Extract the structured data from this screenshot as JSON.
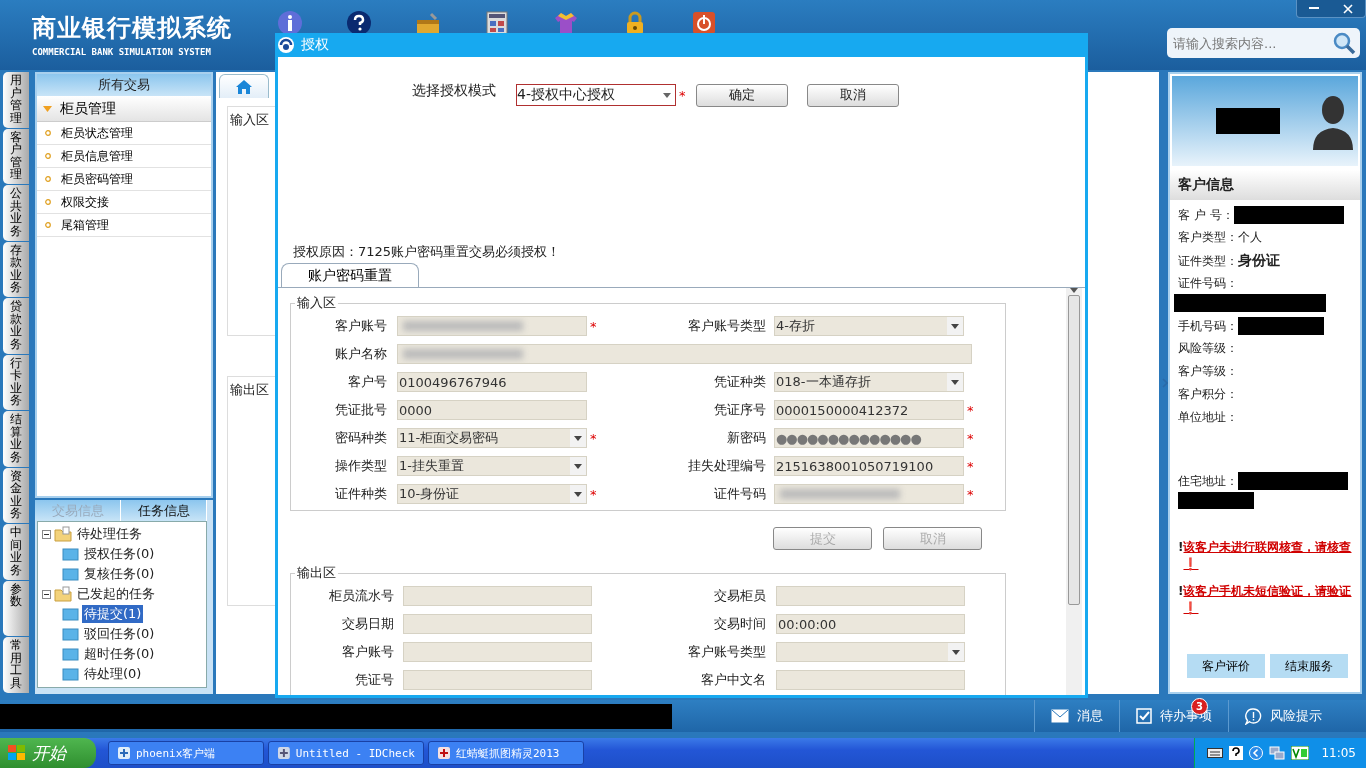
{
  "header": {
    "title": "商业银行模拟系统",
    "subtitle": "COMMERCIAL BANK SIMULATION SYSTEM",
    "search": {
      "placeholder": "请输入搜索内容..."
    }
  },
  "side_tabs": [
    {
      "label": "用户管理"
    },
    {
      "label": "客户管理"
    },
    {
      "label": "公共业务"
    },
    {
      "label": "存款业务"
    },
    {
      "label": "贷款业务"
    },
    {
      "label": "行卡业务"
    },
    {
      "label": "结算业务"
    },
    {
      "label": "资金业务"
    },
    {
      "label": "中间业务"
    },
    {
      "label": "参数"
    },
    {
      "label": "常用工具"
    }
  ],
  "nav": {
    "title": "所有交易",
    "groups": [
      {
        "label": "柜员管理",
        "expanded": true,
        "items": [
          {
            "label": "柜员状态管理"
          },
          {
            "label": "柜员信息管理"
          },
          {
            "label": "柜员密码管理"
          },
          {
            "label": "权限交接"
          },
          {
            "label": "尾箱管理"
          }
        ]
      }
    ]
  },
  "task_panel": {
    "tabs": [
      {
        "label": "交易信息",
        "selected": false
      },
      {
        "label": "任务信息",
        "selected": true
      }
    ],
    "tree": [
      {
        "label": "待处理任务",
        "expanded": true,
        "children": [
          {
            "label": "授权任务(0)",
            "selected": false
          },
          {
            "label": "复核任务(0)",
            "selected": false
          }
        ]
      },
      {
        "label": "已发起的任务",
        "expanded": true,
        "children": [
          {
            "label": "待提交(1)",
            "selected": true
          },
          {
            "label": "驳回任务(0)",
            "selected": false
          },
          {
            "label": "超时任务(0)",
            "selected": false
          },
          {
            "label": "待处理(0)",
            "selected": false
          }
        ]
      }
    ]
  },
  "workspace": {
    "input_label": "输入区",
    "output_label": "输出区"
  },
  "dialog": {
    "title": "授权",
    "mode": {
      "label": "选择授权模式",
      "value": "4-授权中心授权",
      "required_mark": "*"
    },
    "buttons": [
      {
        "label": "确定"
      },
      {
        "label": "取消"
      }
    ],
    "reason": "授权原因：7125账户密码重置交易必须授权！",
    "tab": {
      "label": "账户密码重置",
      "selected": true
    },
    "input": {
      "legend": "输入区",
      "rows": [
        {
          "fields": [
            {
              "label": "客户账号",
              "kind": "text",
              "blurred": true,
              "required_mark": "*"
            },
            {
              "label": "客户账号类型",
              "kind": "select",
              "value": "4-存折"
            }
          ]
        },
        {
          "fields": [
            {
              "label": "账户名称",
              "kind": "wide",
              "blurred": true
            }
          ]
        },
        {
          "fields": [
            {
              "label": "客户号",
              "kind": "text",
              "value": "0100496767946"
            },
            {
              "label": "凭证种类",
              "kind": "select",
              "value": "018-一本通存折"
            }
          ]
        },
        {
          "fields": [
            {
              "label": "凭证批号",
              "kind": "text",
              "value": "0000"
            },
            {
              "label": "凭证序号",
              "kind": "text",
              "value": "0000150000412372",
              "required_mark": "*"
            }
          ]
        },
        {
          "fields": [
            {
              "label": "密码种类",
              "kind": "select",
              "value": "11-柜面交易密码",
              "required_mark": "*"
            },
            {
              "label": "新密码",
              "kind": "password",
              "value": "●●●●●●●●●●●●●●",
              "required_mark": "*"
            }
          ]
        },
        {
          "fields": [
            {
              "label": "操作类型",
              "kind": "select",
              "value": "1-挂失重置"
            },
            {
              "label": "挂失处理编号",
              "kind": "text",
              "value": "2151638001050719100",
              "required_mark": "*"
            }
          ]
        },
        {
          "fields": [
            {
              "label": "证件种类",
              "kind": "select",
              "value": "10-身份证",
              "required_mark": "*"
            },
            {
              "label": "证件号码",
              "kind": "text",
              "blurred": true,
              "required_mark": "*"
            }
          ]
        }
      ]
    },
    "actions": [
      {
        "label": "提交",
        "disabled": true
      },
      {
        "label": "取消",
        "disabled": true
      }
    ],
    "output": {
      "legend": "输出区",
      "rows": [
        {
          "fields": [
            {
              "label": "柜员流水号",
              "kind": "text"
            },
            {
              "label": "交易柜员",
              "kind": "text"
            }
          ]
        },
        {
          "fields": [
            {
              "label": "交易日期",
              "kind": "text"
            },
            {
              "label": "交易时间",
              "kind": "text",
              "value": "00:00:00"
            }
          ]
        },
        {
          "fields": [
            {
              "label": "客户账号",
              "kind": "text"
            },
            {
              "label": "客户账号类型",
              "kind": "select"
            }
          ]
        },
        {
          "fields": [
            {
              "label": "凭证号",
              "kind": "text"
            },
            {
              "label": "客户中文名",
              "kind": "text"
            }
          ]
        }
      ]
    }
  },
  "customer": {
    "name_redacted": true,
    "title": "客户信息",
    "fields": [
      {
        "label": "客 户 号：",
        "kind": "line",
        "redacted": true
      },
      {
        "label": "客户类型：",
        "kind": "line",
        "value": "个人",
        "emphasis": false
      },
      {
        "label": "证件类型：",
        "kind": "line",
        "value": "身份证",
        "emphasis": true
      },
      {
        "label": "证件号码：",
        "kind": "line",
        "redacted": true
      },
      {
        "label": "手机号码：",
        "kind": "line",
        "redacted": true
      },
      {
        "label": "风险等级：",
        "kind": "line"
      },
      {
        "label": "客户等级：",
        "kind": "line"
      },
      {
        "label": "客户积分：",
        "kind": "line"
      },
      {
        "label": "单位地址：",
        "kind": "address"
      },
      {
        "label": "住宅地址：",
        "kind": "address",
        "redacted": true
      }
    ],
    "warnings": [
      {
        "mark": "!",
        "text": "该客户未进行联网核查，请核查❗"
      },
      {
        "mark": "!",
        "text": "该客户手机未短信验证，请验证❗"
      }
    ],
    "buttons": [
      {
        "label": "客户评价"
      },
      {
        "label": "结束服务"
      }
    ]
  },
  "status_bar": {
    "items": [
      {
        "kind": "message",
        "label": "消息"
      },
      {
        "kind": "todo",
        "label": "待办事项",
        "badge": "3"
      },
      {
        "kind": "risk",
        "label": "风险提示"
      }
    ]
  },
  "taskbar": {
    "start": "开始",
    "tasks": [
      {
        "label": "phoenix客户端"
      },
      {
        "label": "Untitled - IDCheck"
      },
      {
        "label": "红蜻蜓抓图精灵2013"
      }
    ],
    "clock": "11:05"
  }
}
